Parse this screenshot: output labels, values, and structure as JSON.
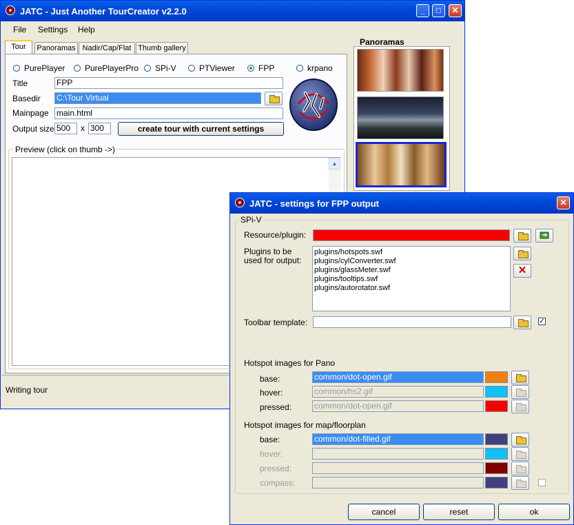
{
  "main_window": {
    "title": "JATC - Just Another TourCreator v2.2.0",
    "menu": [
      "File",
      "Settings",
      "Help"
    ],
    "tabs": [
      "Tour",
      "Panoramas",
      "Nadir/Cap/Flat",
      "Thumb gallery"
    ],
    "active_tab": "Tour",
    "players": [
      "PurePlayer",
      "PurePlayerPro",
      "SPi-V",
      "PTViewer",
      "FPP",
      "krpano"
    ],
    "selected_player": "FPP",
    "title_label": "Title",
    "title_value": "FPP",
    "basedir_label": "Basedir",
    "basedir_value": "C:\\Tour Virtual",
    "mainpage_label": "Mainpage",
    "mainpage_value": "main.html",
    "output_size_label": "Output size",
    "output_width": "500",
    "output_x": "x",
    "output_height": "300",
    "create_button": "create tour with current settings",
    "preview_label": "Preview  (click on thumb ->)",
    "panoramas_label": "Panoramas",
    "status_text": "Writing tour"
  },
  "settings_dialog": {
    "title": "JATC - settings for FPP output",
    "group_title": "SPi-V",
    "resource_label": "Resource/plugin:",
    "plugins_label_1": "Plugins to be",
    "plugins_label_2": "used for output:",
    "plugins": [
      "plugins/hotspots.swf",
      "plugins/cylConverter.swf",
      "plugins/glassMeter.swf",
      "plugins/tooltips.swf",
      "plugins/autorotator.swf"
    ],
    "toolbar_label": "Toolbar template:",
    "toolbar_value": "",
    "toolbar_checked": true,
    "pano_hotspots_title": "Hotspot images for Pano",
    "pano_hotspots": [
      {
        "label": "base:",
        "value": "common/dot-open.gif",
        "color": "#f08010",
        "enabled": true
      },
      {
        "label": "hover:",
        "value": "common/hs2.gif",
        "color": "#10c0f8",
        "enabled": false
      },
      {
        "label": "pressed:",
        "value": "common/dot-open.gif",
        "color": "#f80000",
        "enabled": false
      }
    ],
    "map_hotspots_title": "Hotspot images for map/floorplan",
    "map_hotspots": [
      {
        "label": "base:",
        "value": "common/dot-filled.gif",
        "color": "#404080",
        "enabled": true
      },
      {
        "label": "hover:",
        "value": "",
        "color": "#10c0f8",
        "enabled": false
      },
      {
        "label": "pressed:",
        "value": "",
        "color": "#800000",
        "enabled": false
      },
      {
        "label": "compass:",
        "value": "",
        "color": "#404080",
        "enabled": false
      }
    ],
    "compass_checked": false,
    "buttons": {
      "cancel": "cancel",
      "reset": "reset",
      "ok": "ok"
    },
    "colors": {
      "resource_field": "#f80000",
      "selection": "#3b8cf0"
    }
  }
}
